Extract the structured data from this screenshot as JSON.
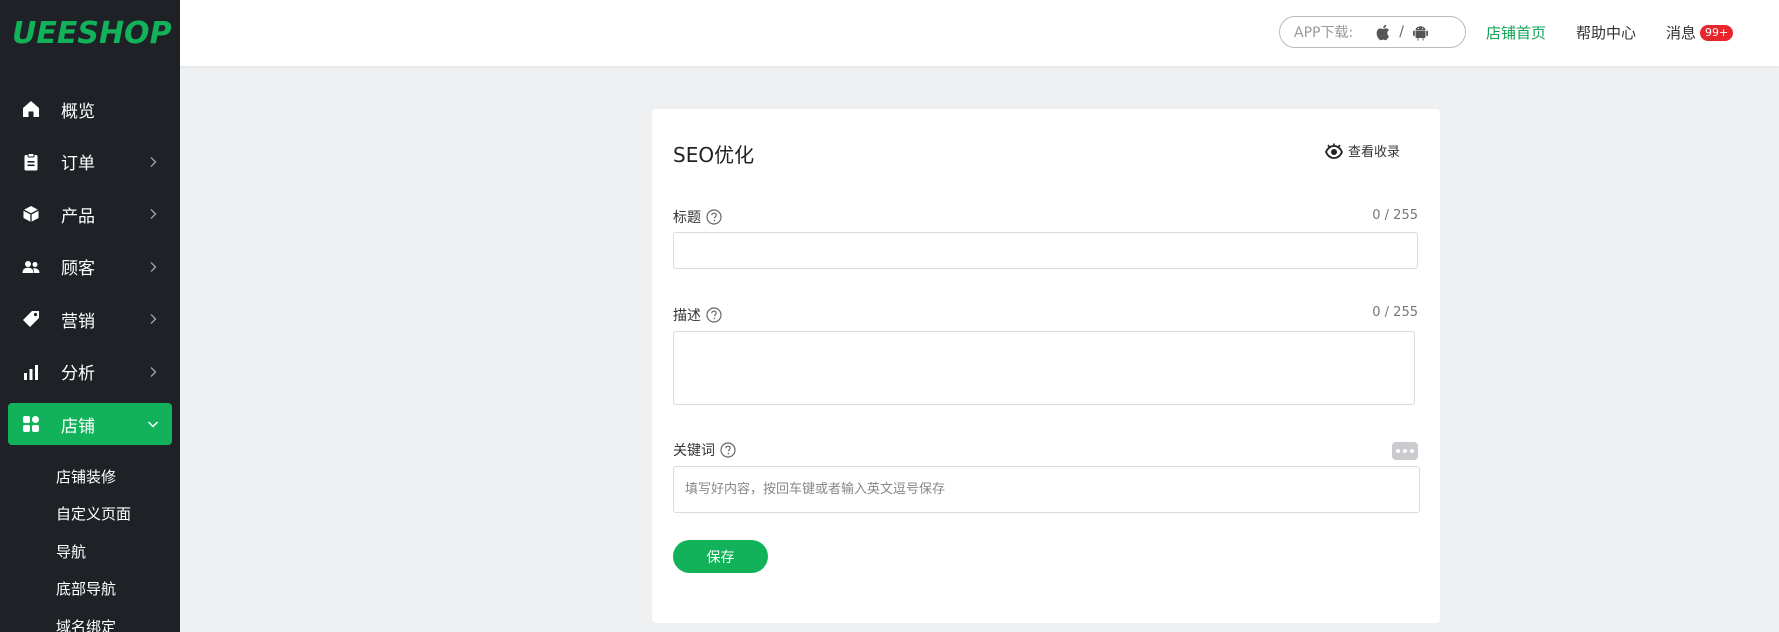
{
  "logo": "UEESHOP",
  "sidebar": {
    "items": [
      {
        "label": "概览",
        "icon": "home-icon"
      },
      {
        "label": "订单",
        "icon": "clipboard-icon"
      },
      {
        "label": "产品",
        "icon": "box-icon"
      },
      {
        "label": "顾客",
        "icon": "users-icon"
      },
      {
        "label": "营销",
        "icon": "tag-icon"
      },
      {
        "label": "分析",
        "icon": "bar-chart-icon"
      },
      {
        "label": "店铺",
        "icon": "grid-icon"
      }
    ],
    "subitems": [
      "店铺装修",
      "自定义页面",
      "导航",
      "底部导航",
      "域名绑定"
    ]
  },
  "topbar": {
    "app_download": "APP下载:",
    "separator": "/",
    "store_home": "店铺首页",
    "help_center": "帮助中心",
    "messages": "消息",
    "messages_badge": "99+"
  },
  "seo": {
    "title": "SEO优化",
    "view_index": "查看收录",
    "title_label": "标题",
    "title_counter": "0 / 255",
    "title_value": "",
    "desc_label": "描述",
    "desc_counter": "0 / 255",
    "desc_value": "",
    "keywords_label": "关键词",
    "keywords_placeholder": "填写好内容，按回车键或者输入英文逗号保存",
    "save": "保存"
  },
  "colors": {
    "accent": "#12b25a",
    "sidebar_bg": "#1e2227",
    "badge": "#e8262d"
  }
}
